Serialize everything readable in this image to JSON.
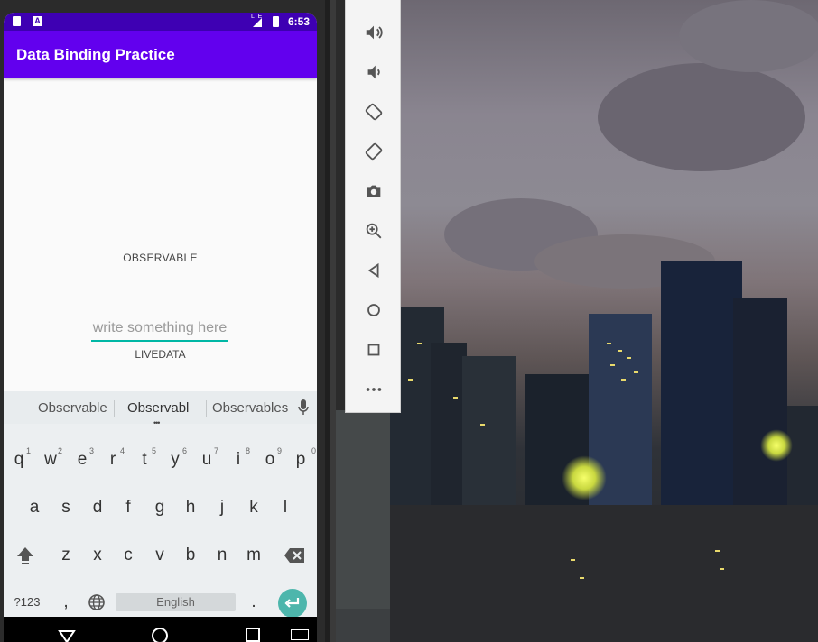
{
  "statusbar": {
    "time": "6:53",
    "network": "LTE"
  },
  "app": {
    "title": "Data Binding Practice"
  },
  "content": {
    "observable_label": "OBSERVABLE",
    "input_placeholder": "write something here",
    "livedata_label": "LIVEDATA"
  },
  "keyboard": {
    "suggestions": [
      "Observable",
      "Observabl",
      "Observables"
    ],
    "row1": [
      {
        "key": "q",
        "hint": "1"
      },
      {
        "key": "w",
        "hint": "2"
      },
      {
        "key": "e",
        "hint": "3"
      },
      {
        "key": "r",
        "hint": "4"
      },
      {
        "key": "t",
        "hint": "5"
      },
      {
        "key": "y",
        "hint": "6"
      },
      {
        "key": "u",
        "hint": "7"
      },
      {
        "key": "i",
        "hint": "8"
      },
      {
        "key": "o",
        "hint": "9"
      },
      {
        "key": "p",
        "hint": "0"
      }
    ],
    "row2": [
      "a",
      "s",
      "d",
      "f",
      "g",
      "h",
      "j",
      "k",
      "l"
    ],
    "row3": [
      "z",
      "x",
      "c",
      "v",
      "b",
      "n",
      "m"
    ],
    "symbols_label": "?123",
    "comma": ",",
    "space_label": "English",
    "period": "."
  },
  "colors": {
    "primary": "#6200ee",
    "primary_dark": "#3e00b3",
    "accent": "#00b7a5",
    "enter": "#4db6ac"
  },
  "toolbar_icons": [
    "volume-up-icon",
    "volume-down-icon",
    "rotate-left-icon",
    "rotate-right-icon",
    "camera-icon",
    "zoom-icon",
    "back-icon",
    "home-icon",
    "overview-icon",
    "more-icon"
  ]
}
